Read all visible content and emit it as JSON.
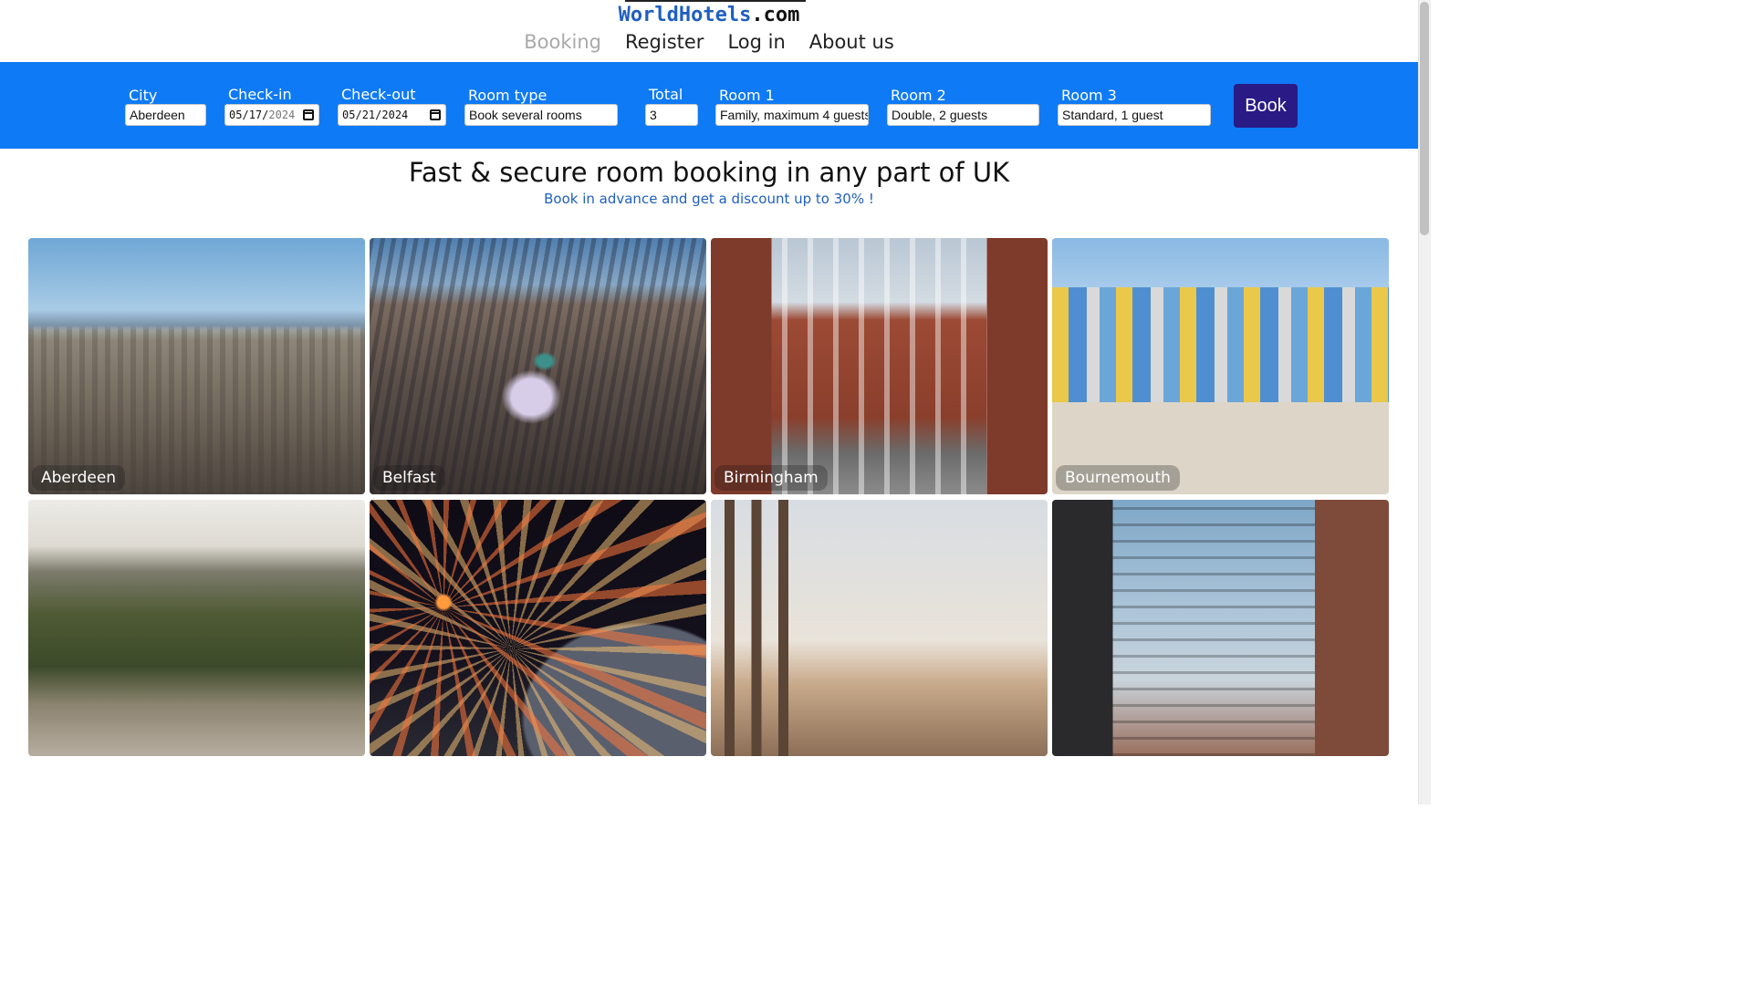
{
  "header": {
    "logo_brand": "WorldHotels",
    "logo_tld": ".com",
    "nav": [
      {
        "label": "Booking",
        "active": true
      },
      {
        "label": "Register"
      },
      {
        "label": "Log in"
      },
      {
        "label": "About us"
      }
    ]
  },
  "booking_form": {
    "city": {
      "label": "City",
      "value": "Aberdeen"
    },
    "check_in": {
      "label": "Check-in",
      "month": "05",
      "day": "17",
      "year": "2024"
    },
    "check_out": {
      "label": "Check-out",
      "month": "05",
      "day": "21",
      "year": "2024"
    },
    "room_type": {
      "label": "Room type",
      "value": "Book several rooms"
    },
    "total": {
      "label": "Total",
      "value": "3"
    },
    "room1": {
      "label": "Room 1",
      "value": "Family, maximum 4 guests"
    },
    "room2": {
      "label": "Room 2",
      "value": "Double, 2 guests"
    },
    "room3": {
      "label": "Room 3",
      "value": "Standard, 1 guest"
    },
    "book_label": "Book",
    "accent_color": "#0f7af5",
    "button_color": "#2a1a86"
  },
  "hero": {
    "title": "Fast & secure room booking in any part of UK",
    "subtitle": "Book in advance and get a discount up to 30% !"
  },
  "cities": [
    {
      "name": "Aberdeen"
    },
    {
      "name": "Belfast"
    },
    {
      "name": "Birmingham"
    },
    {
      "name": "Bournemouth"
    },
    {
      "name": ""
    },
    {
      "name": ""
    },
    {
      "name": ""
    },
    {
      "name": ""
    }
  ]
}
